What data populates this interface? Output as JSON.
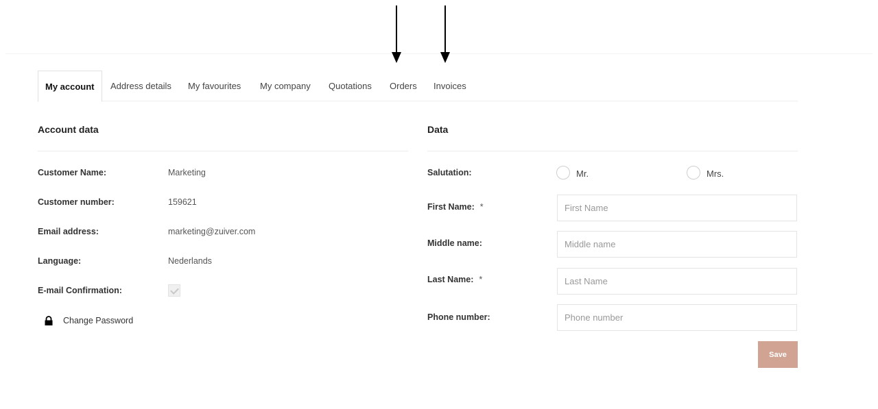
{
  "tabs": [
    {
      "label": "My account",
      "active": true
    },
    {
      "label": "Address details"
    },
    {
      "label": "My favourites"
    },
    {
      "label": "My company"
    },
    {
      "label": "Quotations"
    },
    {
      "label": "Orders"
    },
    {
      "label": "Invoices"
    }
  ],
  "account": {
    "heading": "Account data",
    "rows": [
      {
        "label": "Customer Name:",
        "value": "Marketing"
      },
      {
        "label": "Customer number:",
        "value": "159621"
      },
      {
        "label": "Email address:",
        "value": "marketing@zuiver.com"
      },
      {
        "label": "Language:",
        "value": "Nederlands"
      },
      {
        "label": "E-mail Confirmation:",
        "checked": true
      }
    ],
    "change_password": "Change Password"
  },
  "data": {
    "heading": "Data",
    "salutation_label": "Salutation:",
    "salutation_options": [
      "Mr.",
      "Mrs."
    ],
    "fields": [
      {
        "label": "First Name:",
        "required_mark": "*",
        "placeholder": "First Name"
      },
      {
        "label": "Middle name:",
        "required_mark": "",
        "placeholder": "Middle name"
      },
      {
        "label": "Last Name:",
        "required_mark": "*",
        "placeholder": "Last Name"
      },
      {
        "label": "Phone number:",
        "required_mark": "",
        "placeholder": "Phone number"
      }
    ],
    "save_label": "Save"
  },
  "colors": {
    "save_button": "#d0a393",
    "arrow": "#000000"
  }
}
